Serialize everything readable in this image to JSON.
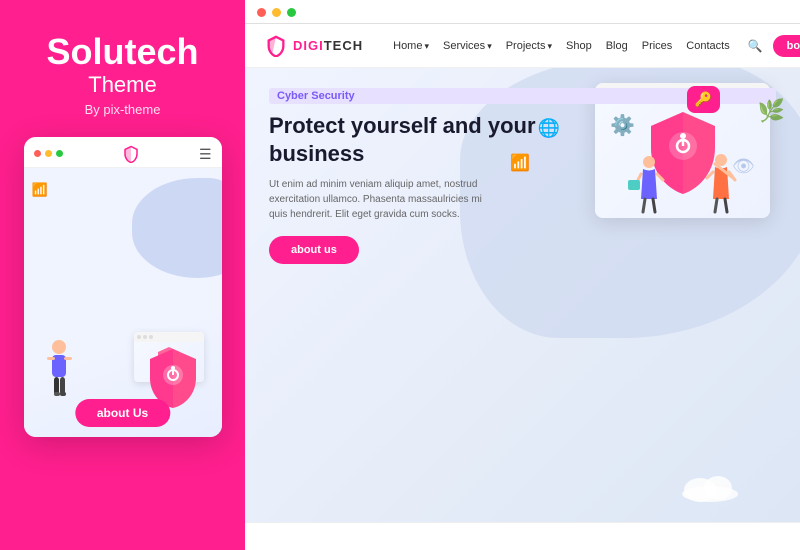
{
  "left": {
    "brand": "Solutech",
    "theme": "Theme",
    "by": "By pix-theme",
    "mobile_about_btn": "about Us"
  },
  "right": {
    "browser_dots": [
      "#FF5F57",
      "#FEBC2E",
      "#28C840"
    ],
    "navbar": {
      "logo_digi": "DIGI",
      "logo_tech": "TECH",
      "links": [
        {
          "label": "Home",
          "has_arrow": true
        },
        {
          "label": "Services",
          "has_arrow": true
        },
        {
          "label": "Projects",
          "has_arrow": true
        },
        {
          "label": "Shop",
          "has_arrow": false
        },
        {
          "label": "Blog",
          "has_arrow": false
        },
        {
          "label": "Prices",
          "has_arrow": false
        },
        {
          "label": "Contacts",
          "has_arrow": false
        }
      ],
      "booked_btn": "booked"
    },
    "hero": {
      "cyber_label": "Cyber Security",
      "title": "Protect yourself and your business",
      "description": "Ut enim ad minim veniam aliquip amet, nostrud exercitation ullamco. Phasenta massaulricies mi quis hendrerit. Elit eget gravida cum socks.",
      "about_btn": "about us"
    }
  },
  "mobile_dots": [
    "#FF5F57",
    "#FEBC2E",
    "#28C840"
  ]
}
